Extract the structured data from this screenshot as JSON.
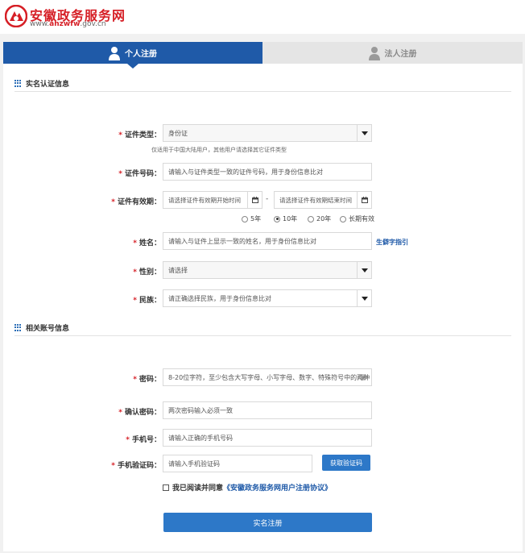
{
  "header": {
    "logo_icon": "anhui-gov-logo-icon",
    "site_name": "安徽政务服务网",
    "url_prefix": "www.",
    "url_domain": "ahzwfw",
    "url_suffix": ".gov.cn"
  },
  "tabs": [
    {
      "label": "个人注册",
      "icon": "person-icon",
      "active": true
    },
    {
      "label": "法人注册",
      "icon": "person-icon",
      "active": false
    }
  ],
  "sections": {
    "identity": {
      "title": "实名认证信息",
      "icon": "grid-icon"
    },
    "account": {
      "title": "相关账号信息",
      "icon": "grid-icon"
    }
  },
  "form": {
    "id_type": {
      "label": "证件类型：",
      "value": "身份证",
      "hint": "仅适用于中国大陆用户，其他用户请选择其它证件类型"
    },
    "id_number": {
      "label": "证件号码：",
      "placeholder": "请输入与证件类型一致的证件号码，用于身份信息比对"
    },
    "validity": {
      "label": "证件有效期：",
      "start_placeholder": "请选择证件有效期开始时间",
      "end_placeholder": "请选择证件有效期结束时间",
      "separator": "-",
      "options": [
        "5年",
        "10年",
        "20年",
        "长期有效"
      ],
      "selected": "10年"
    },
    "name": {
      "label": "姓名：",
      "placeholder": "请输入与证件上显示一致的姓名，用于身份信息比对",
      "link": "生僻字指引"
    },
    "gender": {
      "label": "性别：",
      "value": "请选择"
    },
    "ethnicity": {
      "label": "民族：",
      "value": "请正确选择民族，用于身份信息比对"
    },
    "password": {
      "label": "密码：",
      "placeholder": "8-20位字符，至少包含大写字母、小写字母、数字、特殊符号中的两种"
    },
    "confirm_password": {
      "label": "确认密码：",
      "placeholder": "两次密码输入必须一致"
    },
    "phone": {
      "label": "手机号：",
      "placeholder": "请输入正确的手机号码"
    },
    "sms_code": {
      "label": "手机验证码：",
      "placeholder": "请输入手机验证码",
      "button": "获取验证码"
    },
    "agreement": {
      "prefix": "我已阅读并同意",
      "link": "《安徽政务服务网用户注册协议》"
    },
    "submit": "实名注册"
  },
  "colors": {
    "brand_red": "#d61f26",
    "tab_blue": "#1f5aa8",
    "button_blue": "#2d78c8"
  }
}
